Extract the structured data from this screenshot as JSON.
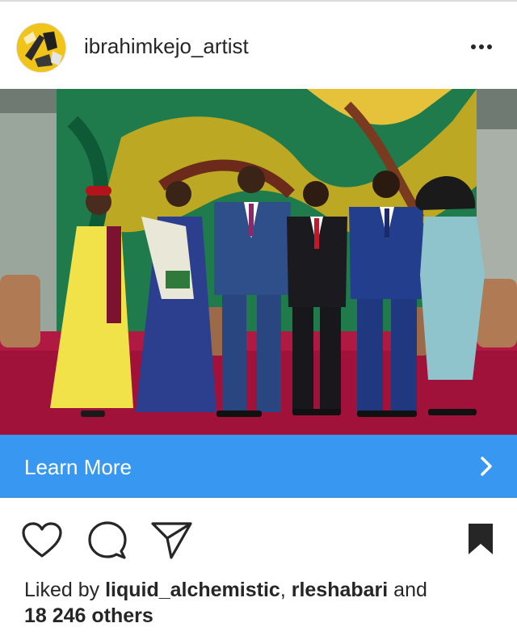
{
  "post": {
    "username": "ibrahimkejo_artist",
    "cta_label": "Learn More",
    "likes": {
      "prefix": "Liked by ",
      "user1": "liquid_alchemistic",
      "separator": ", ",
      "user2": "rleshabari",
      "suffix": " and",
      "others": "18 246 others"
    }
  },
  "icons": {
    "avatar": "painted-logo-avatar",
    "more": "more-options-icon",
    "cta": "chevron-right-icon",
    "like": "heart-icon",
    "comment": "comment-icon",
    "share": "send-icon",
    "save": "bookmark-icon"
  },
  "colors": {
    "cta_bg": "#3897f0",
    "text": "#262626",
    "separator": "#dbdbdb"
  }
}
